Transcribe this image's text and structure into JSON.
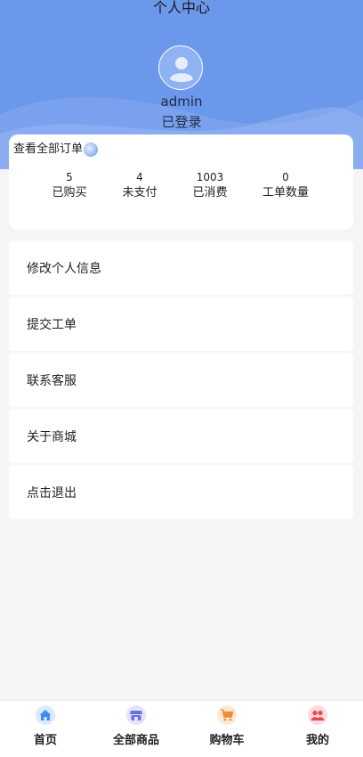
{
  "header": {
    "title": "个人中心",
    "username": "admin",
    "login_status": "已登录",
    "avatar_icon": "user-avatar-icon",
    "background_color": "#6b98ea"
  },
  "orders": {
    "view_all_label": "查看全部订单",
    "stats": [
      {
        "value": "5",
        "label": "已购买"
      },
      {
        "value": "4",
        "label": "未支付"
      },
      {
        "value": "1003",
        "label": "已消费"
      },
      {
        "value": "0",
        "label": "工单数量"
      }
    ]
  },
  "menu": {
    "items": [
      {
        "label": "修改个人信息"
      },
      {
        "label": "提交工单"
      },
      {
        "label": "联系客服"
      },
      {
        "label": "关于商城"
      },
      {
        "label": "点击退出"
      }
    ]
  },
  "tabbar": {
    "items": [
      {
        "label": "首页",
        "icon": "home-icon",
        "color": "#3d8ff0"
      },
      {
        "label": "全部商品",
        "icon": "store-icon",
        "color": "#6b6fe0"
      },
      {
        "label": "购物车",
        "icon": "cart-icon",
        "color": "#f28a2e"
      },
      {
        "label": "我的",
        "icon": "users-icon",
        "color": "#e8474f"
      }
    ]
  }
}
